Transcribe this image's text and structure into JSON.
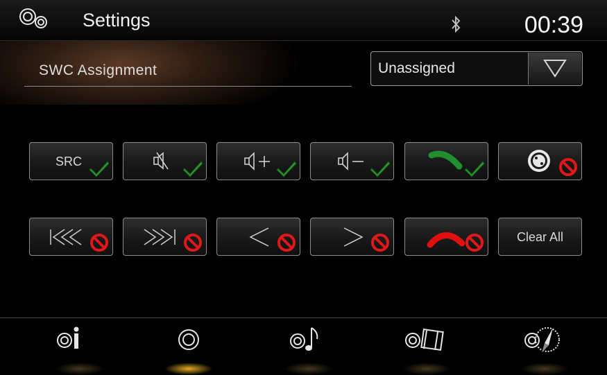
{
  "header": {
    "title": "Settings",
    "settings_icon": "gears-icon",
    "bluetooth_icon": "bluetooth-icon",
    "clock": "00:39"
  },
  "assignment": {
    "label": "SWC  Assignment",
    "dropdown_value": "Unassigned",
    "dropdown_icon": "triangle-down-icon"
  },
  "buttons_row1": [
    {
      "label": "SRC",
      "icon": "src-icon",
      "status": "assigned"
    },
    {
      "icon": "mute-icon",
      "status": "assigned"
    },
    {
      "icon": "volume-up-icon",
      "status": "assigned"
    },
    {
      "icon": "volume-down-icon",
      "status": "assigned"
    },
    {
      "icon": "phone-answer-icon",
      "status": "assigned"
    },
    {
      "icon": "voice-icon",
      "status": "unassigned"
    }
  ],
  "buttons_row2": [
    {
      "icon": "skip-back-icon",
      "status": "unassigned"
    },
    {
      "icon": "skip-forward-icon",
      "status": "unassigned"
    },
    {
      "icon": "previous-icon",
      "status": "unassigned"
    },
    {
      "icon": "next-icon",
      "status": "unassigned"
    },
    {
      "icon": "phone-hangup-icon",
      "status": "unassigned"
    },
    {
      "label": "Clear All"
    }
  ],
  "nav": [
    {
      "icon": "info-icon"
    },
    {
      "icon": "settings-icon",
      "active": true
    },
    {
      "icon": "music-icon"
    },
    {
      "icon": "video-icon"
    },
    {
      "icon": "navigation-icon"
    }
  ],
  "colors": {
    "check": "#2f9a2f",
    "prohibited": "#e01818",
    "phone_green": "#1f8f2f",
    "phone_red": "#e01010",
    "active_glow": "#ffbe28"
  }
}
